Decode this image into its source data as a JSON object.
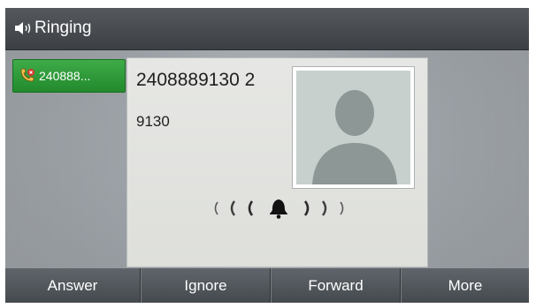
{
  "status_bar": {
    "icon": "speaker-icon",
    "title": "Ringing"
  },
  "line_key": {
    "icon": "incoming-call-icon",
    "label": "240888..."
  },
  "call_info": {
    "caller_number": "2408889130 2",
    "extension": "9130",
    "avatar_icon": "person-silhouette-icon",
    "ring_icon": "ringing-bell-icon"
  },
  "softkeys": [
    {
      "label": "Answer"
    },
    {
      "label": "Ignore"
    },
    {
      "label": "Forward"
    },
    {
      "label": "More"
    }
  ],
  "colors": {
    "status_bar": "#44484c",
    "line_key": "#2f9a3a",
    "softkey": "#52575c",
    "card": "#e3e4e1"
  }
}
